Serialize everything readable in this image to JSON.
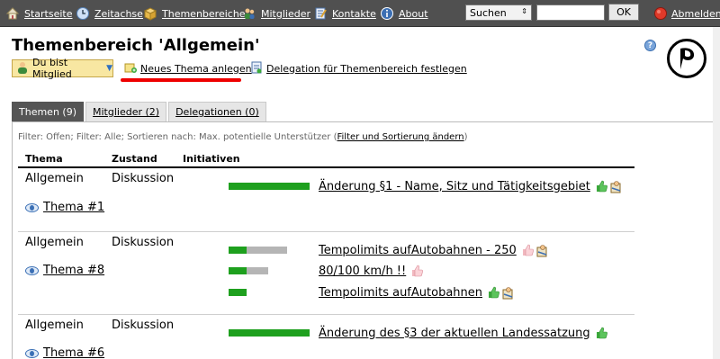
{
  "nav": {
    "items": [
      {
        "label": "Startseite",
        "icon": "house-icon"
      },
      {
        "label": "Zeitachse",
        "icon": "clock-icon"
      },
      {
        "label": "Themenbereiche",
        "icon": "box-icon"
      },
      {
        "label": "Mitglieder",
        "icon": "people-icon"
      },
      {
        "label": "Kontakte",
        "icon": "notebook-icon"
      },
      {
        "label": "About",
        "icon": "info-icon"
      }
    ],
    "search_select": "Suchen",
    "search_value": "",
    "ok_label": "OK",
    "logout_label": "Abmelden"
  },
  "header": {
    "title": "Themenbereich 'Allgemein'",
    "member_label": "Du bist Mitglied",
    "new_topic_label": "Neues Thema anlegen",
    "delegation_label": "Delegation für Themenbereich festlegen"
  },
  "tabs": [
    {
      "label": "Themen (9)",
      "active": true
    },
    {
      "label": "Mitglieder (2)",
      "active": false
    },
    {
      "label": "Delegationen (0)",
      "active": false
    }
  ],
  "filter": {
    "text": "Filter: Offen; Filter: Alle; Sortieren nach: Max. potentielle Unterstützer (",
    "link": "Filter und Sortierung ändern",
    "close": ")"
  },
  "table": {
    "headers": [
      "Thema",
      "Zustand",
      "Initiativen"
    ],
    "rows": [
      {
        "area": "Allgemein",
        "state": "Diskussion",
        "topic": "Thema #1",
        "initiatives": [
          {
            "name": "Änderung §1 - Name, Sitz und Tätigkeitsgebiet",
            "support": 1.0,
            "potential": 0.0,
            "thumb": "thumbs-up-green-icon",
            "delegation": true
          }
        ]
      },
      {
        "area": "Allgemein",
        "state": "Diskussion",
        "topic": "Thema #8",
        "initiatives": [
          {
            "name": "Tempolimits aufAutobahnen - 250",
            "support": 0.22,
            "potential": 0.5,
            "thumb": "thumbs-up-pink-icon",
            "delegation": true
          },
          {
            "name": "80/100 km/h !!",
            "support": 0.22,
            "potential": 0.27,
            "thumb": "thumbs-up-pink-icon",
            "delegation": false
          },
          {
            "name": "Tempolimits aufAutobahnen",
            "support": 0.22,
            "potential": 0.0,
            "thumb": "thumbs-up-green-icon",
            "delegation": true
          }
        ]
      },
      {
        "area": "Allgemein",
        "state": "Diskussion",
        "topic": "Thema #6",
        "initiatives": [
          {
            "name": "Änderung des §3 der aktuellen Landessatzung",
            "support": 1.0,
            "potential": 0.0,
            "thumb": "thumbs-up-green-icon",
            "delegation": false
          }
        ]
      }
    ]
  },
  "colors": {
    "nav_bg": "#505050",
    "support": "#1ea01e",
    "potential": "#b5b5b5",
    "highlight": "#e00000"
  }
}
